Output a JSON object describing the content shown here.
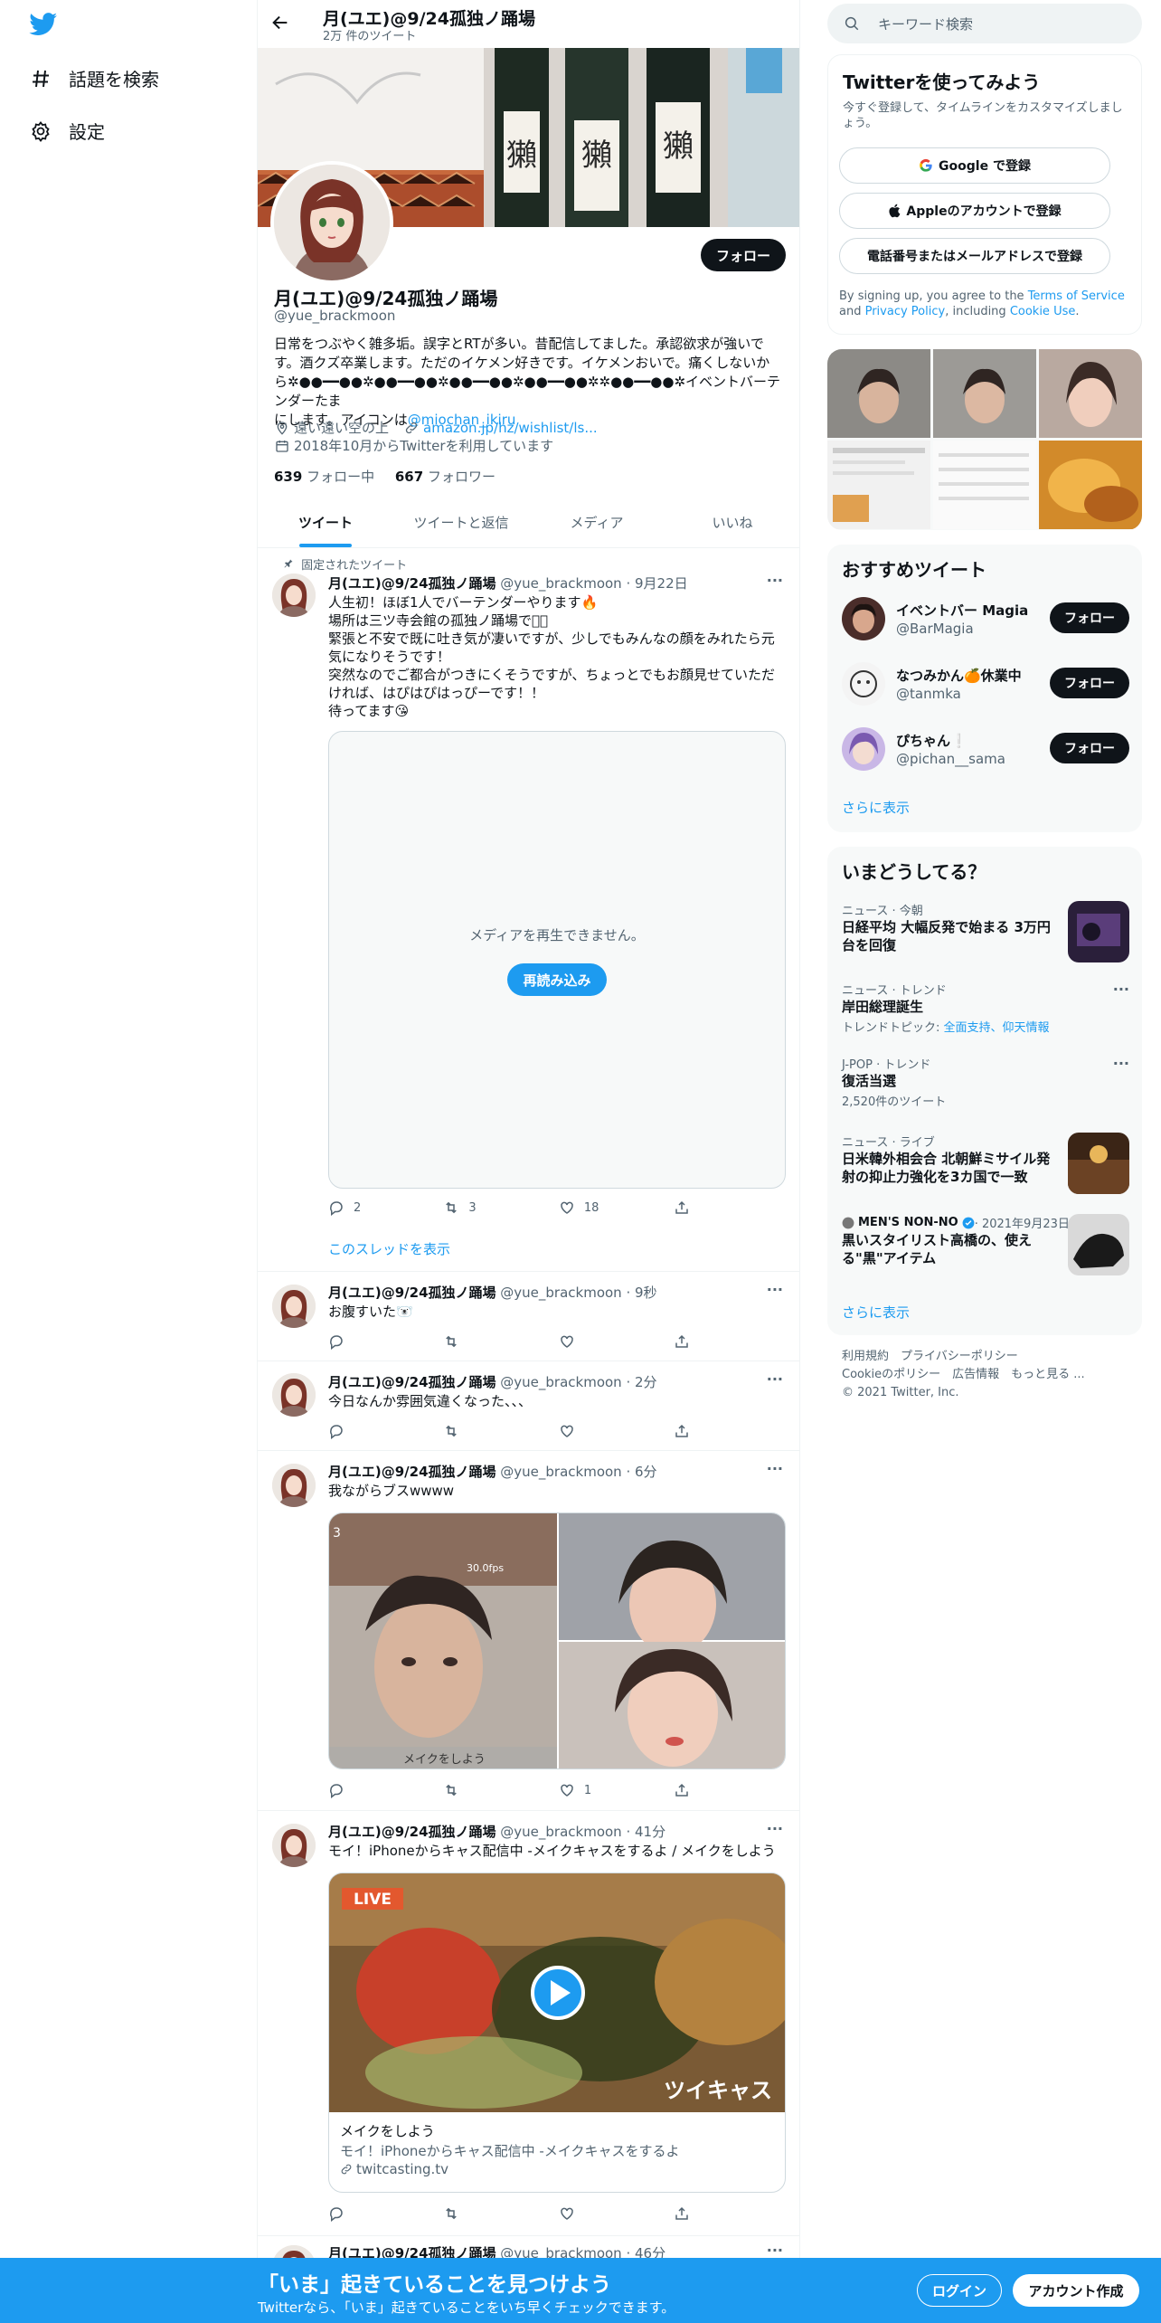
{
  "nav": {
    "explore_label": "話題を検索",
    "settings_label": "設定"
  },
  "header": {
    "name": "月(ユエ)@9/24孤独ノ踊場",
    "tweet_count": "2万 件のツイート"
  },
  "profile": {
    "follow_label": "フォロー",
    "name": "月(ユエ)@9/24孤独ノ踊場",
    "handle": "@yue_brackmoon",
    "bio_1": "日常をつぶやく雑多垢。誤字とRTが多い。昔配信してました。承認欲求が強いで",
    "bio_2": "す。酒クズ卒業します。ただのイケメン好きです。イケメンおいで。痛くしないか",
    "bio_3": "ら✲●●━━●●✲●●━━●●✲●●━━●●✲●●━━●●✲✲●●━━●●✲イベントバーテンダーたま",
    "bio_4": "にします。アイコンは",
    "bio_link": "@miochan_ikiru",
    "location": "遠い遠い空の上",
    "website": "amazon.jp/hz/wishlist/ls...",
    "joined": "2018年10月からTwitterを利用しています",
    "following_count": "639",
    "following_label": " フォロー中",
    "followers_count": "667",
    "followers_label": " フォロワー"
  },
  "tabs": [
    "ツイート",
    "ツイートと返信",
    "メディア",
    "いいね"
  ],
  "tweets": {
    "pinned_label": "固定されたツイート",
    "t1": {
      "name": "月(ユエ)@9/24孤独ノ踊場",
      "meta": " @yue_brackmoon · 9月22日",
      "lines": [
        "人生初！ほぼ1人でバーテンダーやります🔥",
        "場所は三ツ寺会館の孤独ノ踊場です🏻",
        "緊張と不安で既に吐き気が凄いですが、少しでもみんなの顔をみれたら元",
        "気になりそうです！",
        "突然なのでご都合がつきにくそうですが、ちょっとでもお顔見せていただ",
        "ければ、はぴはぴはっぴーです！！",
        "待ってます😘"
      ],
      "media_error": "メディアを再生できません。",
      "reload": "再読み込み",
      "replies": "2",
      "retweets": "3",
      "likes": "18",
      "thread": "このスレッドを表示"
    },
    "t2": {
      "name": "月(ユエ)@9/24孤独ノ踊場",
      "meta": " @yue_brackmoon · 9秒",
      "text": "お腹すいた🐻‍❄️"
    },
    "t3": {
      "name": "月(ユエ)@9/24孤独ノ踊場",
      "meta": " @yue_brackmoon · 2分",
      "text": "今日なんか雰囲気違くなった、、、"
    },
    "t4": {
      "name": "月(ユエ)@9/24孤独ノ踊場",
      "meta": " @yue_brackmoon · 6分",
      "text": "我ながらブスwwww",
      "likes": "1",
      "overlay_fps": "30.0fps",
      "overlay_makeup": "メイクをしよう",
      "overlay_count": "3"
    },
    "t5": {
      "name": "月(ユエ)@9/24孤独ノ踊場",
      "meta": " @yue_brackmoon · 41分",
      "text": "モイ！iPhoneからキャス配信中 -メイクキャスをするよ / メイクをしよう",
      "live": "LIVE",
      "brand": "ツイキャス",
      "card_title": "メイクをしよう",
      "card_desc": "モイ！iPhoneからキャス配信中 -メイクキャスをするよ",
      "card_domain": "twitcasting.tv"
    },
    "t6": {
      "name": "月(ユエ)@9/24孤独ノ踊場",
      "meta": " @yue_brackmoon · 46分"
    }
  },
  "right": {
    "search_placeholder": "キーワード検索",
    "signup": {
      "title": "Twitterを使ってみよう",
      "subtitle": "今すぐ登録して、タイムラインをカスタマイズしましょう。",
      "google": "Google で登録",
      "apple": "Appleのアカウントで登録",
      "phone": "電話番号またはメールアドレスで登録",
      "terms_1": "By signing up, you agree to the ",
      "terms_tos": "Terms of Service",
      "terms_2": " and ",
      "terms_privacy": "Privacy Policy",
      "terms_3": ", including ",
      "terms_cookie": "Cookie Use",
      "terms_4": "."
    },
    "recommend": {
      "title": "おすすめツイート",
      "items": [
        {
          "name": "イベントバー Magia",
          "handle": "@BarMagia",
          "button": "フォロー"
        },
        {
          "name": "なつみかん🍊休業中",
          "handle": "@tanmka",
          "button": "フォロー"
        },
        {
          "name": "ぴちゃん❕",
          "handle": "@pichan__sama",
          "button": "フォロー"
        }
      ],
      "more": "さらに表示"
    },
    "trends": {
      "title": "いまどうしてる？",
      "items": [
        {
          "context": "ニュース · 今朝",
          "title": "日経平均 大幅反発で始まる 3万円台を回復"
        },
        {
          "context": "ニュース · トレンド",
          "title": "岸田総理誕生",
          "extra_label": "トレンドトピック: ",
          "extra_links": "全面支持、仰天情報"
        },
        {
          "context": "J-POP · トレンド",
          "title": "復活当選",
          "extra_label": "2,520件のツイート"
        },
        {
          "context": "ニュース · ライブ",
          "title": "日米韓外相会合 北朝鮮ミサイル発射の抑止力強化を3カ国で一致"
        },
        {
          "context": "MEN'S NON-NO",
          "date": " · 2021年9月23日",
          "title": "黒いスタイリスト高橋の、使える\"黒\"アイテム"
        }
      ],
      "more": "さらに表示"
    },
    "footer": {
      "line1": "利用規約　プライバシーポリシー",
      "line2": "Cookieのポリシー　広告情報　もっと見る ...",
      "line3": "© 2021 Twitter, Inc."
    }
  },
  "bottom_bar": {
    "title": "「いま」起きていることを見つけよう",
    "subtitle": "Twitterなら、「いま」起きていることをいち早くチェックできます。",
    "login": "ログイン",
    "signup": "アカウント作成"
  },
  "colors": {
    "accent": "#1d9bf0",
    "text": "#0f1419",
    "muted": "#536471"
  }
}
